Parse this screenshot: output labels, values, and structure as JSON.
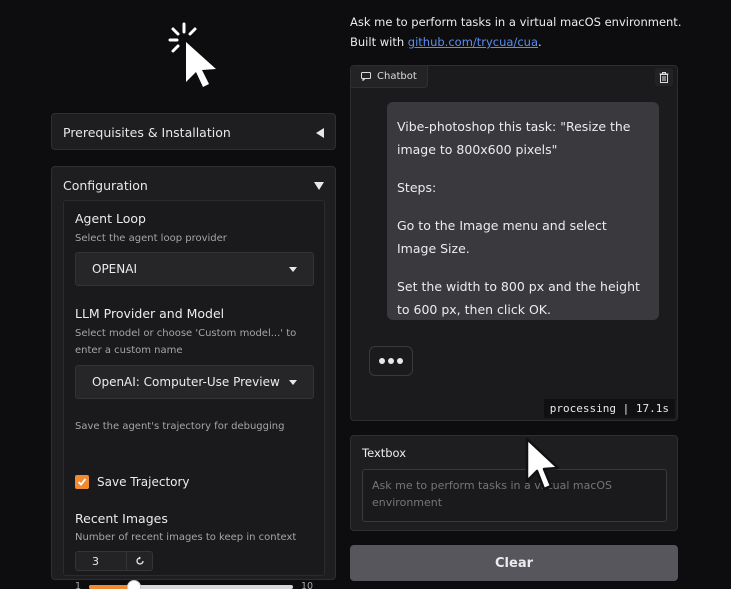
{
  "header": {
    "intro_line1": "Ask me to perform tasks in a virtual macOS environment.",
    "intro_built_prefix": "Built with ",
    "intro_link": "github.com/trycua/cua",
    "intro_link_suffix": "."
  },
  "left": {
    "prereq_title": "Prerequisites & Installation",
    "config_title": "Configuration",
    "agent_loop": {
      "label": "Agent Loop",
      "desc": "Select the agent loop provider",
      "value": "OPENAI"
    },
    "llm": {
      "label": "LLM Provider and Model",
      "desc": "Select model or choose 'Custom model...' to enter a custom name",
      "value": "OpenAI: Computer-Use Preview"
    },
    "trajectory": {
      "desc": "Save the agent's trajectory for debugging",
      "label": "Save Trajectory",
      "checked": true
    },
    "recent_images": {
      "label": "Recent Images",
      "desc": "Number of recent images to keep in context",
      "value": "3",
      "min": "1",
      "max": "10",
      "fraction": 0.222
    }
  },
  "chatbot": {
    "tag": "Chatbot",
    "message_p1": "Vibe-photoshop this task: \"Resize the image to 800x600 pixels\"",
    "message_p2": "Steps:",
    "message_p3": "Go to the Image menu and select Image Size.",
    "message_p4": "Set the width to 800 px and the height to 600 px, then click OK.",
    "status": "processing | 17.1s"
  },
  "textbox": {
    "label": "Textbox",
    "placeholder": "Ask me to perform tasks in a virtual macOS environment"
  },
  "clear_label": "Clear",
  "colors": {
    "accent": "#f08a32",
    "link": "#5a8dee",
    "background": "#0d0d0f"
  }
}
